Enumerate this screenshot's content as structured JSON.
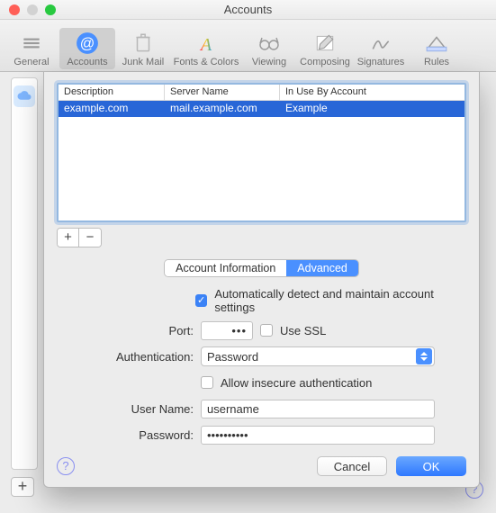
{
  "window": {
    "title": "Accounts"
  },
  "toolbar": [
    {
      "id": "general",
      "label": "General",
      "selected": false
    },
    {
      "id": "accounts",
      "label": "Accounts",
      "selected": true
    },
    {
      "id": "junk",
      "label": "Junk Mail",
      "selected": false
    },
    {
      "id": "fonts",
      "label": "Fonts & Colors",
      "selected": false
    },
    {
      "id": "viewing",
      "label": "Viewing",
      "selected": false
    },
    {
      "id": "composing",
      "label": "Composing",
      "selected": false
    },
    {
      "id": "signatures",
      "label": "Signatures",
      "selected": false
    },
    {
      "id": "rules",
      "label": "Rules",
      "selected": false
    }
  ],
  "table": {
    "columns": [
      "Description",
      "Server Name",
      "In Use By Account"
    ],
    "rows": [
      {
        "description": "example.com",
        "server": "mail.example.com",
        "inuse": "Example"
      }
    ]
  },
  "buttons": {
    "plus": "+",
    "minus": "−"
  },
  "tabs": {
    "info": "Account Information",
    "advanced": "Advanced"
  },
  "auto_detect": {
    "checked": true,
    "label": "Automatically detect and maintain account settings"
  },
  "port": {
    "label": "Port:",
    "value": "•••"
  },
  "ssl": {
    "checked": false,
    "label": "Use SSL"
  },
  "auth": {
    "label": "Authentication:",
    "value": "Password"
  },
  "insecure": {
    "checked": false,
    "label": "Allow insecure authentication"
  },
  "username": {
    "label": "User Name:",
    "value": "username"
  },
  "password": {
    "label": "Password:",
    "value": "••••••••••"
  },
  "help": "?",
  "cancel": "Cancel",
  "ok": "OK"
}
